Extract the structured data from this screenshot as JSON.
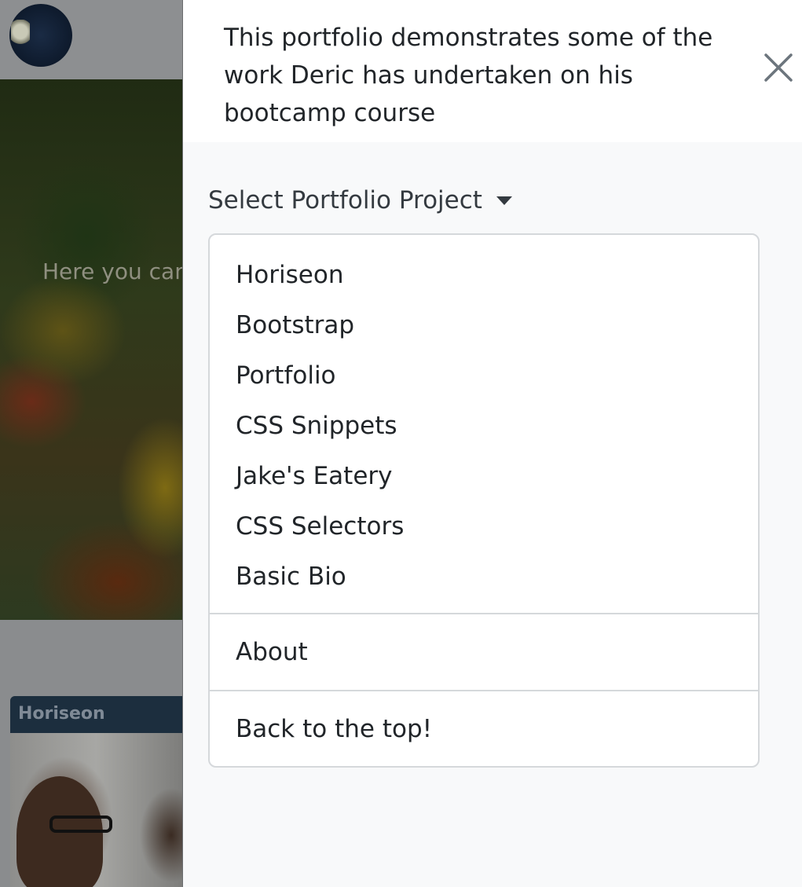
{
  "background_page": {
    "hero_text": "Here you can",
    "card_title": "Horiseon"
  },
  "offcanvas": {
    "title": "This portfolio demonstrates some of the work Deric has undertaken on his bootcamp course",
    "close_icon": "close-icon",
    "dropdown": {
      "toggle_label": "Select Portfolio Project",
      "projects": [
        {
          "label": "Horiseon"
        },
        {
          "label": "Bootstrap"
        },
        {
          "label": "Portfolio"
        },
        {
          "label": "CSS Snippets"
        },
        {
          "label": "Jake's Eatery"
        },
        {
          "label": "CSS Selectors"
        },
        {
          "label": "Basic Bio"
        }
      ],
      "about_label": "About",
      "back_to_top_label": "Back to the top!"
    }
  },
  "colors": {
    "panel_background": "#f8f9fa",
    "header_background": "#ffffff",
    "text": "#212529",
    "border": "#d5d8db"
  }
}
